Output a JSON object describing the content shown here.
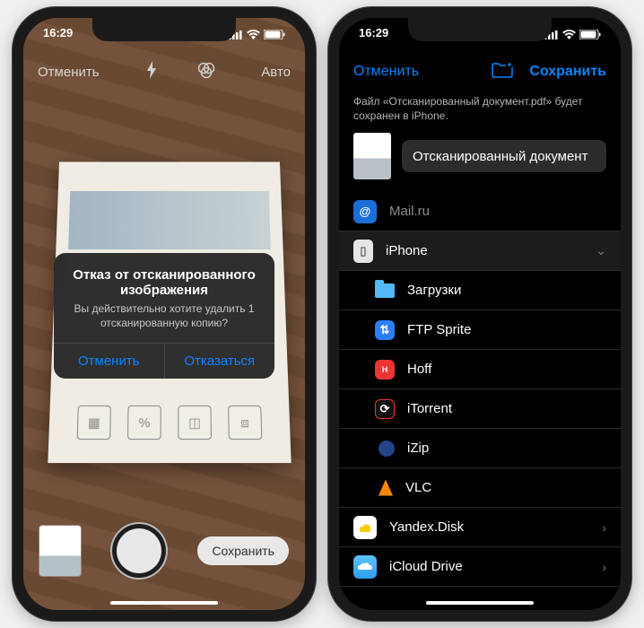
{
  "status": {
    "time": "16:29"
  },
  "scanner": {
    "cancel": "Отменить",
    "auto": "Авто",
    "save": "Сохранить",
    "alert": {
      "title": "Отказ от отсканированного изображения",
      "message": "Вы действительно хотите удалить 1 отсканированную копию?",
      "cancel": "Отменить",
      "discard": "Отказаться"
    }
  },
  "files": {
    "cancel": "Отменить",
    "save": "Сохранить",
    "info": "Файл «Отсканированный документ.pdf» будет сохранен в iPhone.",
    "doc_name": "Отсканированный документ",
    "locations": {
      "mailru": "Mail.ru",
      "iphone": "iPhone",
      "yandex": "Yandex.Disk",
      "icloud": "iCloud Drive"
    },
    "iphone_folders": [
      "Загрузки",
      "FTP Sprite",
      "Hoff",
      "iTorrent",
      "iZip",
      "VLC"
    ]
  }
}
